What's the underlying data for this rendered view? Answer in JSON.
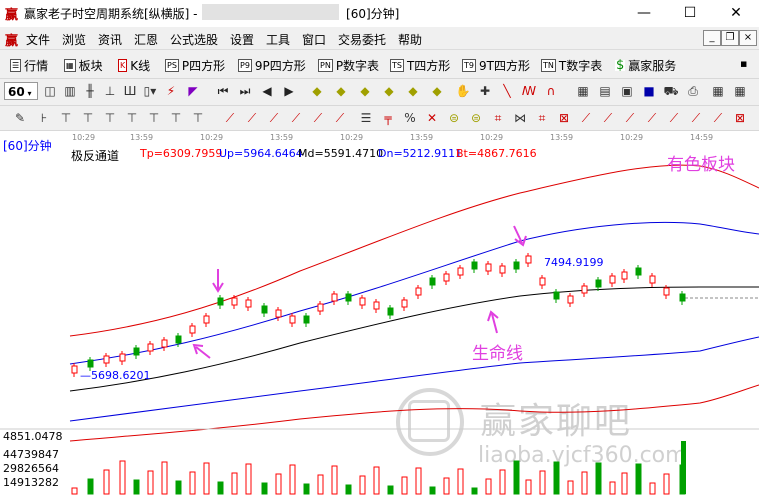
{
  "window": {
    "title_prefix": "赢家老子时空周期系统[纵横版] - [",
    "title_suffix": "[60]分钟]",
    "minimize": "—",
    "maximize": "☐",
    "close": "✕"
  },
  "menu": {
    "items": [
      "文件",
      "浏览",
      "资讯",
      "汇恩",
      "公式选股",
      "设置",
      "工具",
      "窗口",
      "交易委托",
      "帮助"
    ],
    "mdi_min": "_",
    "mdi_restore": "❐",
    "mdi_close": "×"
  },
  "toolbar1": {
    "items": [
      {
        "icon": "☰",
        "label": "行情"
      },
      {
        "icon": "▦",
        "label": "板块"
      },
      {
        "icon": "K",
        "label": "K线"
      },
      {
        "icon": "PS",
        "label": "P四方形"
      },
      {
        "icon": "P9",
        "label": "9P四方形"
      },
      {
        "icon": "PN",
        "label": "P数字表"
      },
      {
        "icon": "TS",
        "label": "T四方形"
      },
      {
        "icon": "T9",
        "label": "9T四方形"
      },
      {
        "icon": "TN",
        "label": "T数字表"
      },
      {
        "icon": "$",
        "label": "赢家服务"
      }
    ]
  },
  "toolbar2": {
    "period": "60"
  },
  "chart": {
    "period_label": "[60]分钟",
    "indicator_name": "极反通道",
    "params": [
      {
        "name": "Tp",
        "text": "Tp=6309.7959",
        "color": "#ff0000"
      },
      {
        "name": "Up",
        "text": "Up=5964.6464",
        "color": "#0000ff"
      },
      {
        "name": "Md",
        "text": "Md=5591.4710",
        "color": "#000000"
      },
      {
        "name": "Dn",
        "text": "Dn=5212.9111",
        "color": "#0000ff"
      },
      {
        "name": "Bt",
        "text": "Bt=4867.7616",
        "color": "#ff0000"
      }
    ],
    "time_ticks": [
      "10:29",
      "13:59",
      "10:29",
      "13:59",
      "10:29",
      "13:59",
      "10:29",
      "13:59",
      "10:29",
      "14:59"
    ],
    "high_label": "7494.9199",
    "low_label": "5698.6201",
    "annotation_board": "有色板块",
    "annotation_lifeline": "生命线",
    "volume_labels": [
      "4851.0478",
      "44739847",
      "29826564",
      "14913282"
    ],
    "watermark_text": "赢家聊吧",
    "watermark_url": "liaoba.yjcf360.com"
  },
  "colors": {
    "up": "#ff0000",
    "down": "#00a000",
    "band_outer": "#dd0000",
    "band_inner": "#0000dd",
    "mid": "#000000",
    "accent": "#e040e0"
  }
}
